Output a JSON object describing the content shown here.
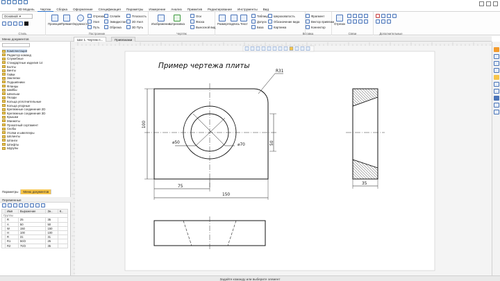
{
  "menu": {
    "items": [
      "3D Модель",
      "Чертеж",
      "Сборка",
      "Оформление",
      "Спецификация",
      "Параметры",
      "Измерение",
      "Анализ",
      "Примитив",
      "Редактирование",
      "Инструменты",
      "Вид"
    ],
    "active_index": 1
  },
  "ribbon": {
    "style_select": "Основной",
    "style_group": "Стиль",
    "build_group": "Построение",
    "build_buttons": {
      "projection": "Проекция",
      "line": "Прямая",
      "circle": "Окружность"
    },
    "build_items": [
      "Отрезок",
      "Сплайн",
      "Плоскость",
      "Узел",
      "Эквидистанта",
      "2D Узел",
      "Путь",
      "Обрезка",
      "3D Путь"
    ],
    "drawing_group": "Чертёж",
    "drawing_buttons": {
      "view": "Изображение",
      "hatch": "Штриховка"
    },
    "drawing_items": [
      "Оси",
      "Фаска",
      "Выносной вид"
    ],
    "annot_items": [
      "Размер",
      "Надпись",
      "Текст",
      "Таблица",
      "Допуск",
      "База",
      "Шероховатость",
      "Обозначение вида",
      "Картинка"
    ],
    "insert_group": "Вставка",
    "insert_items": [
      "Фрагмент",
      "Вектор привязки",
      "Коннектор"
    ],
    "links_group": "Связи",
    "segment_label": "Отрезок",
    "extra_group": "Дополнительные"
  },
  "left_panel": {
    "header": "Меню документов",
    "search_placeholder": "",
    "tree": [
      "Комплектация",
      "Редактор команд",
      "Служебные",
      "Стандартные изделия 14",
      "Болты",
      "Винты",
      "Гайки",
      "Заклепки",
      "Подшипники",
      "Фланцы",
      "Шайбы",
      "Шпильки",
      "Гвозди",
      "Кольца уплотнительные",
      "Кольца упорные",
      "Крепежные соединения 2D",
      "Крепежные соединения 3D",
      "Крышки",
      "Манжеты",
      "Прокатный сортамент",
      "Скобы",
      "Уголки и швеллеры",
      "Шплинты",
      "Штанги",
      "Штифты",
      "Шурупы"
    ],
    "selected_index": 0,
    "tabs": [
      "Параметры",
      "Меню документов"
    ],
    "active_tab": 1
  },
  "variables": {
    "header": "Переменные",
    "columns": [
      "Имя",
      "Выражение",
      "Зн..",
      "К.."
    ],
    "group_label": "Группы",
    "rows": [
      [
        "R",
        "25",
        "35",
        ""
      ],
      [
        "A",
        "50",
        "50",
        ""
      ],
      [
        "W",
        "150",
        "150",
        ""
      ],
      [
        "H",
        "100",
        "100",
        ""
      ],
      [
        "R",
        "31",
        "31",
        ""
      ],
      [
        "R1",
        "50/2",
        "25",
        ""
      ],
      [
        "R2",
        "70/2",
        "35",
        ""
      ]
    ]
  },
  "doc_tabs": [
    "Шаг 1. Чертеж п...",
    "Привязками"
  ],
  "drawing": {
    "title": "Пример чертежа плиты",
    "dims": {
      "r31": "R31",
      "h100": "100",
      "d50": "⌀50",
      "d70": "⌀70",
      "v50": "50",
      "w75": "75",
      "w150": "150",
      "w35": "35"
    }
  },
  "status": "Задайте команду или выберите элемент",
  "colors": {
    "accent": "#2a6fc9",
    "active_tab": "#f6c44a",
    "selection": "#cfe2f8"
  }
}
